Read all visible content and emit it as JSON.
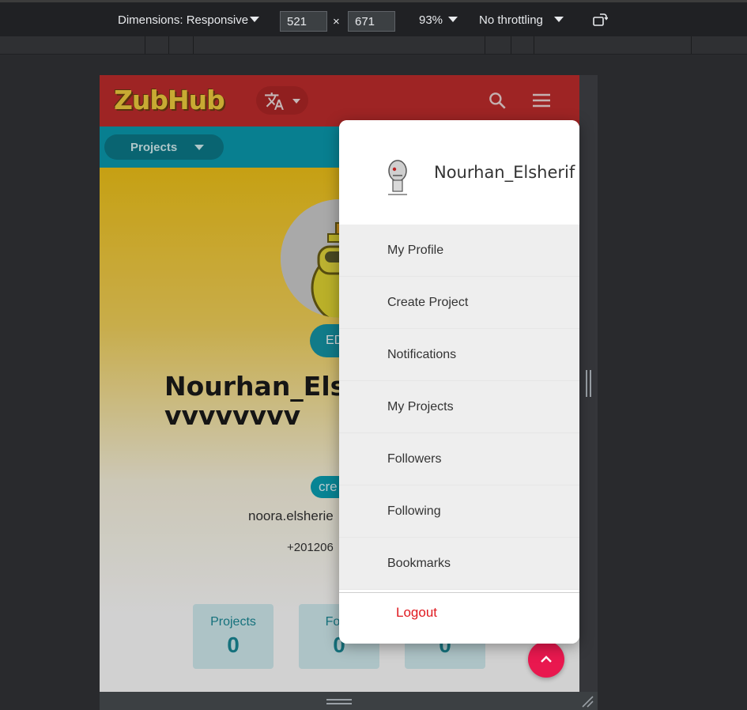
{
  "devtools": {
    "dimensions_label": "Dimensions: Responsive",
    "width": "521",
    "times": "×",
    "height": "671",
    "zoom": "93%",
    "throttling": "No throttling",
    "rotate_icon": "rotate-icon"
  },
  "app": {
    "logo": "ZubHub",
    "translate_icon": "translate-icon",
    "search_icon": "search-icon",
    "menu_icon": "hamburger-menu-icon",
    "projects_dropdown": "Projects",
    "edit_label": "ED",
    "profile_name": "Nourhan_Elsvbbfvbjvbevvvvvvvvvvv",
    "role_badge": "cre",
    "email": "noora.elsherie",
    "phone": "+201206",
    "stats": [
      {
        "label": "Projects",
        "value": "0"
      },
      {
        "label": "Follo",
        "value": "0"
      },
      {
        "label": "",
        "value": "0"
      }
    ]
  },
  "menu": {
    "username": "Nourhan_Elsherif",
    "items": [
      {
        "label": "My Profile"
      },
      {
        "label": "Create Project"
      },
      {
        "label": "Notifications"
      },
      {
        "label": "My Projects"
      },
      {
        "label": "Followers"
      },
      {
        "label": "Following"
      },
      {
        "label": "Bookmarks"
      }
    ],
    "logout": "Logout"
  },
  "colors": {
    "header_red": "#c12d2d",
    "teal": "#0a9bb0",
    "logout_red": "#e0191f",
    "scroll_top": "#e9184f"
  }
}
